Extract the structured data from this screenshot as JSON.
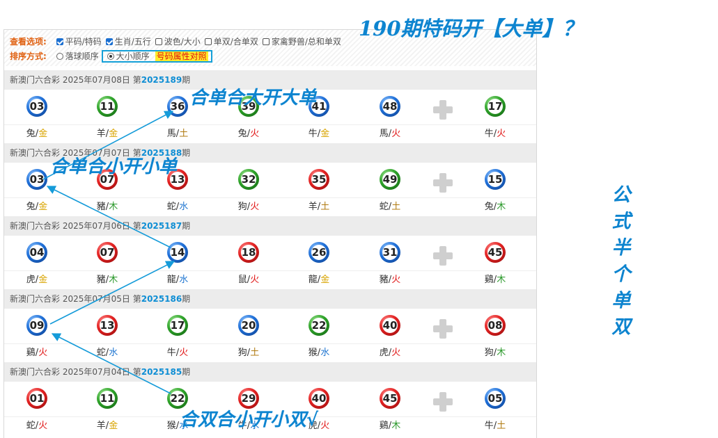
{
  "options": {
    "view_label": "查看选项:",
    "view_items": [
      {
        "label": "平码/特码",
        "checked": true
      },
      {
        "label": "生肖/五行",
        "checked": true
      },
      {
        "label": "波色/大小",
        "checked": false
      },
      {
        "label": "单双/合单双",
        "checked": false
      },
      {
        "label": "家禽野兽/总和单双",
        "checked": false
      }
    ],
    "sort_label": "排序方式:",
    "sort_items": [
      {
        "label": "落球顺序",
        "selected": false
      },
      {
        "label": "大小顺序",
        "selected": true
      }
    ],
    "compare_label": "号码属性对照"
  },
  "draws": [
    {
      "header": "新澳门六合彩 2025年07月08日 第",
      "period": "2025189",
      "suffix": "期",
      "balls": [
        {
          "num": "03",
          "color": "blue",
          "zodiac": "兔",
          "element": "金"
        },
        {
          "num": "11",
          "color": "green",
          "zodiac": "羊",
          "element": "金"
        },
        {
          "num": "36",
          "color": "blue",
          "zodiac": "馬",
          "element": "土"
        },
        {
          "num": "39",
          "color": "green",
          "zodiac": "兔",
          "element": "火"
        },
        {
          "num": "41",
          "color": "blue",
          "zodiac": "牛",
          "element": "金"
        },
        {
          "num": "48",
          "color": "blue",
          "zodiac": "馬",
          "element": "火"
        }
      ],
      "special": {
        "num": "17",
        "color": "green",
        "zodiac": "牛",
        "element": "火"
      }
    },
    {
      "header": "新澳门六合彩 2025年07月07日 第",
      "period": "2025188",
      "suffix": "期",
      "balls": [
        {
          "num": "03",
          "color": "blue",
          "zodiac": "兔",
          "element": "金"
        },
        {
          "num": "07",
          "color": "red",
          "zodiac": "豬",
          "element": "木"
        },
        {
          "num": "13",
          "color": "red",
          "zodiac": "蛇",
          "element": "水"
        },
        {
          "num": "32",
          "color": "green",
          "zodiac": "狗",
          "element": "火"
        },
        {
          "num": "35",
          "color": "red",
          "zodiac": "羊",
          "element": "土"
        },
        {
          "num": "49",
          "color": "green",
          "zodiac": "蛇",
          "element": "土"
        }
      ],
      "special": {
        "num": "15",
        "color": "blue",
        "zodiac": "兔",
        "element": "木"
      }
    },
    {
      "header": "新澳门六合彩 2025年07月06日 第",
      "period": "2025187",
      "suffix": "期",
      "balls": [
        {
          "num": "04",
          "color": "blue",
          "zodiac": "虎",
          "element": "金"
        },
        {
          "num": "07",
          "color": "red",
          "zodiac": "豬",
          "element": "木"
        },
        {
          "num": "14",
          "color": "blue",
          "zodiac": "龍",
          "element": "水"
        },
        {
          "num": "18",
          "color": "red",
          "zodiac": "鼠",
          "element": "火"
        },
        {
          "num": "26",
          "color": "blue",
          "zodiac": "龍",
          "element": "金"
        },
        {
          "num": "31",
          "color": "blue",
          "zodiac": "豬",
          "element": "火"
        }
      ],
      "special": {
        "num": "45",
        "color": "red",
        "zodiac": "鷄",
        "element": "木"
      }
    },
    {
      "header": "新澳门六合彩 2025年07月05日 第",
      "period": "2025186",
      "suffix": "期",
      "balls": [
        {
          "num": "09",
          "color": "blue",
          "zodiac": "鷄",
          "element": "火"
        },
        {
          "num": "13",
          "color": "red",
          "zodiac": "蛇",
          "element": "水"
        },
        {
          "num": "17",
          "color": "green",
          "zodiac": "牛",
          "element": "火"
        },
        {
          "num": "20",
          "color": "blue",
          "zodiac": "狗",
          "element": "土"
        },
        {
          "num": "22",
          "color": "green",
          "zodiac": "猴",
          "element": "水"
        },
        {
          "num": "40",
          "color": "red",
          "zodiac": "虎",
          "element": "火"
        }
      ],
      "special": {
        "num": "08",
        "color": "red",
        "zodiac": "狗",
        "element": "木"
      }
    },
    {
      "header": "新澳门六合彩 2025年07月04日 第",
      "period": "2025185",
      "suffix": "期",
      "balls": [
        {
          "num": "01",
          "color": "red",
          "zodiac": "蛇",
          "element": "火"
        },
        {
          "num": "11",
          "color": "green",
          "zodiac": "羊",
          "element": "金"
        },
        {
          "num": "22",
          "color": "green",
          "zodiac": "猴",
          "element": "水"
        },
        {
          "num": "29",
          "color": "red",
          "zodiac": "牛",
          "element": "水"
        },
        {
          "num": "40",
          "color": "red",
          "zodiac": "虎",
          "element": "火"
        },
        {
          "num": "45",
          "color": "red",
          "zodiac": "鷄",
          "element": "木"
        }
      ],
      "special": {
        "num": "05",
        "color": "blue",
        "zodiac": "牛",
        "element": "土"
      }
    }
  ],
  "annotations": {
    "title": "190期特码开【大单】？",
    "note1": "合单合大开大单",
    "note2": "合单合小开小单",
    "note3": "合双合小开小双√",
    "vertical": "公式半个单双"
  },
  "colors": {
    "accent": "#0d84cf",
    "period": "#0f8ed4",
    "options_label": "#e06010",
    "highlight_bg": "#ffeb2a"
  }
}
